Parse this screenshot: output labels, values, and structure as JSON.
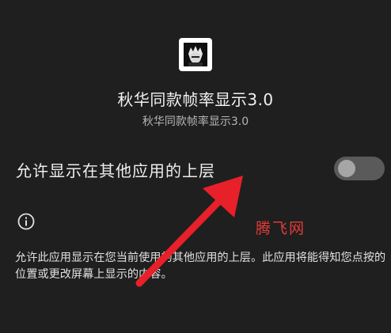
{
  "app": {
    "name": "秋华同款帧率显示3.0",
    "subtitle": "秋华同款帧率显示3.0",
    "icon": "app-avatar-icon"
  },
  "permission": {
    "label": "允许显示在其他应用的上层",
    "enabled": false,
    "description": "允许此应用显示在您当前使用的其他应用的上层。此应用将能得知您点按的位置或更改屏幕上显示的内容。"
  },
  "watermark": {
    "text": "腾飞网",
    "color": "#e53a3a"
  },
  "annotation": {
    "icon": "red-arrow-icon",
    "color": "#e8202a"
  },
  "colors": {
    "background": "#1f1f1f",
    "toggle_track": "#5a5a5a",
    "toggle_knob": "#a6a6a6"
  }
}
